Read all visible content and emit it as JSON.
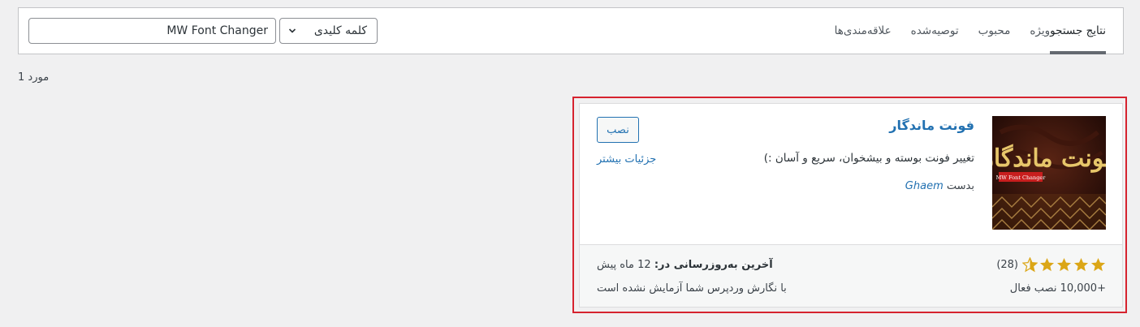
{
  "tabs": [
    {
      "label": "نتایج جستجو",
      "active": true
    },
    {
      "label": "ویژه",
      "active": false
    },
    {
      "label": "محبوب",
      "active": false
    },
    {
      "label": "توصیه‌شده",
      "active": false
    },
    {
      "label": "علاقه‌مندی‌ها",
      "active": false
    }
  ],
  "search": {
    "type_selected": "کلمه کلیدی",
    "value": "MW Font Changer"
  },
  "results_count": "1 مورد",
  "plugin": {
    "name": "فونت ماندگار",
    "description": "تغییر فونت بوسته و بیشخوان، سریع و آسان :)",
    "author_prefix": "بدست",
    "author": "Ghaem",
    "install_label": "نصب",
    "more_details_label": "جزئیات بیشتر",
    "rating_stars": 4.5,
    "rating_count": "(28)",
    "active_installs": "+10,000 نصب فعال",
    "last_updated_label": "آخرین به‌روزرسانی در:",
    "last_updated_value": "12 ماه پیش",
    "compatibility": "با نگارش وردپرس شما آزمایش نشده است",
    "thumbnail_text": "فونت ماندگار",
    "thumbnail_badge": "MW Font Changer"
  },
  "colors": {
    "link": "#2271b1",
    "star": "#dba617",
    "highlight_border": "#d6232f"
  }
}
